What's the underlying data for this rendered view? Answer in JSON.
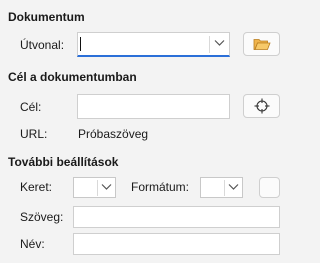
{
  "sections": {
    "document": {
      "title": "Dokumentum",
      "path_label": "Útvonal:",
      "path_value": "",
      "browse_icon": "folder-open-icon"
    },
    "target": {
      "title": "Cél a dokumentumban",
      "target_label": "Cél:",
      "target_value": "",
      "target_icon": "crosshair-icon",
      "url_label": "URL:",
      "url_value": "Próbaszöveg"
    },
    "more": {
      "title": "További beállítások",
      "frame_label": "Keret:",
      "frame_value": "",
      "format_label": "Formátum:",
      "format_value": "",
      "text_label": "Szöveg:",
      "text_value": "",
      "name_label": "Név:",
      "name_value": ""
    }
  },
  "colors": {
    "accent": "#2b6fd8",
    "folder": "#f0b44c"
  }
}
